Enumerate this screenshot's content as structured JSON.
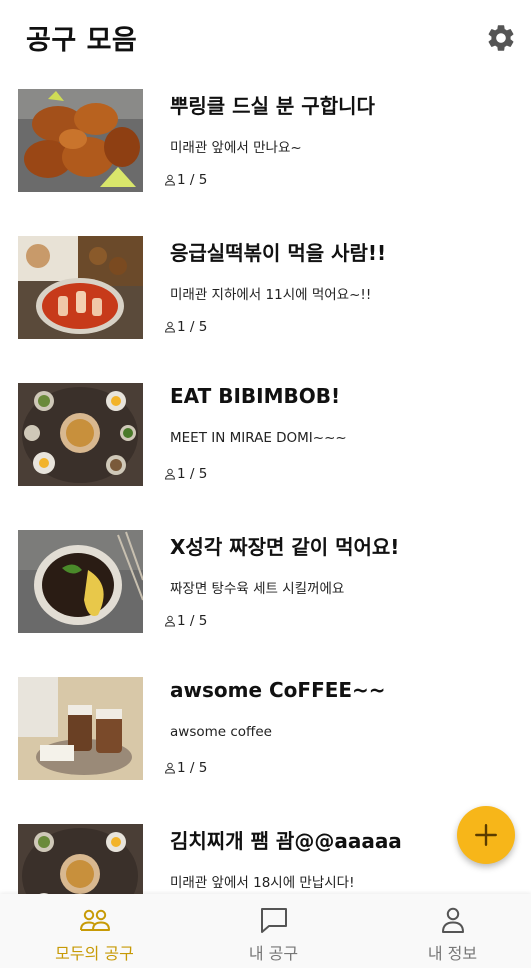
{
  "header": {
    "title": "공구 모음",
    "settings_icon": "gear-icon"
  },
  "posts": [
    {
      "title": "뿌링클 드실 분 구합니다",
      "description": "미래관 앞에서 만나요~",
      "participants": "1 / 5",
      "image": "fried-chicken"
    },
    {
      "title": "응급실떡볶이 먹을 사람!!",
      "description": "미래관 지하에서 11시에 먹어요~!!",
      "participants": "1 / 5",
      "image": "tteokbokki"
    },
    {
      "title": "EAT BIBIMBOB!",
      "description": "MEET IN MIRAE DOMI~~~",
      "participants": "1 / 5",
      "image": "bibimbap-table"
    },
    {
      "title": "X성각 짜장면 같이 먹어요!",
      "description": "짜장면 탕수육 세트 시킬꺼에요",
      "participants": "1 / 5",
      "image": "jajangmyeon"
    },
    {
      "title": "awsome CoFFEE~~",
      "description": "awsome coffee",
      "participants": "1 / 5",
      "image": "iced-coffee"
    },
    {
      "title": "김치찌개 팸 괌@@aaaaa",
      "description": "미래관 앞에서 18시에 만납시다!",
      "participants": "1 / 5",
      "image": "bibimbap-table"
    }
  ],
  "fab": {
    "icon": "plus-icon"
  },
  "bottom_nav": {
    "items": [
      {
        "label": "모두의 공구",
        "icon": "group-icon",
        "active": true
      },
      {
        "label": "내 공구",
        "icon": "chat-bubble-icon",
        "active": false
      },
      {
        "label": "내 정보",
        "icon": "person-icon",
        "active": false
      }
    ]
  },
  "colors": {
    "accent": "#f7b619",
    "active_nav": "#c79a06",
    "inactive_nav": "#777777"
  }
}
